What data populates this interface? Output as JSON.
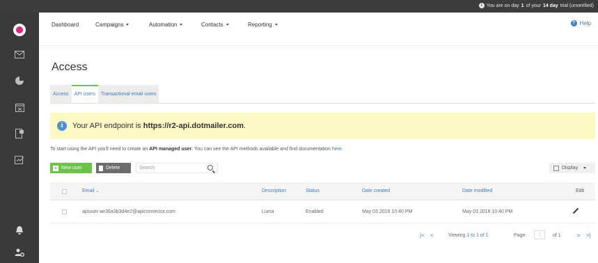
{
  "topbar": {
    "trial_prefix": "You are on day",
    "trial_day": "1",
    "trial_mid": "of your",
    "trial_length": "14 day",
    "trial_suffix": "trial (unverified)"
  },
  "rail": {
    "icons": [
      "envelope-icon",
      "pie-chart-icon",
      "calendar-icon",
      "mobile-icon",
      "report-icon",
      "bell-icon",
      "user-settings-icon"
    ]
  },
  "nav": {
    "items": [
      {
        "label": "Dashboard"
      },
      {
        "label": "Campaigns"
      },
      {
        "label": "Automation"
      },
      {
        "label": "Contacts"
      },
      {
        "label": "Reporting"
      }
    ],
    "help": "Help"
  },
  "page": {
    "title": "Access"
  },
  "tabs": [
    {
      "label": "Access"
    },
    {
      "label": "API users"
    },
    {
      "label": "Transactional email users"
    }
  ],
  "banner": {
    "prefix": "Your API endpoint is",
    "endpoint": "https://r2-api.dotmailer.com",
    "suffix": "."
  },
  "intro": {
    "pre": "To start using the API you'll need to create an",
    "bold": "API managed user",
    "mid": ". You can see the API methods available and find documentation",
    "link": "here",
    "end": "."
  },
  "toolbar": {
    "new_user": "New user",
    "delete": "Delete",
    "search_placeholder": "Search",
    "display": "Display"
  },
  "table": {
    "headers": {
      "email": "Email",
      "description": "Description",
      "status": "Status",
      "created": "Date created",
      "modified": "Date modified",
      "edit": "Edit"
    },
    "rows": [
      {
        "email": "apiuser-ae36a3b3d4e2@apiconnector.com",
        "description": "Luma",
        "status": "Enabled",
        "created": "May 03 2018 10:40 PM",
        "modified": "May 03 2018 10:40 PM"
      }
    ]
  },
  "pagination": {
    "viewing_prefix": "Viewing",
    "viewing_range": "1 to 1 of 1",
    "page_label": "Page",
    "page_value": "1",
    "of_total": "of 1",
    "first": "|<",
    "prev": "<",
    "next": ">",
    "last": ">|"
  },
  "colors": {
    "accent_green": "#6cc24a",
    "link_blue": "#3b7bbf",
    "banner_yellow": "#fcf8c4",
    "rail_dark": "#3a3a3a"
  }
}
